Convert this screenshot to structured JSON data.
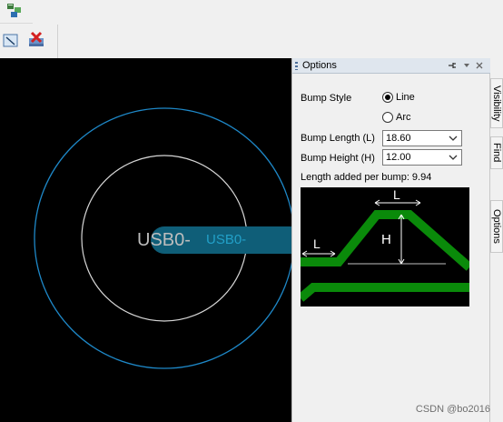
{
  "toolbar": {
    "top_icon": "component-stack-icon",
    "second_icons": [
      "select-rect-icon",
      "delete-red-icon"
    ]
  },
  "canvas": {
    "pad_label": "USB0-",
    "trace_label": "USB0-",
    "colors": {
      "background": "#000000",
      "outer_ring": "#1e88c8",
      "inner_ring": "#d6d6d6",
      "trace": "#0f5e78",
      "pad_text": "#bdbdbd",
      "trace_text": "#22a0c8"
    }
  },
  "options_panel": {
    "title": "Options",
    "bump_style": {
      "label": "Bump Style",
      "options": [
        "Line",
        "Arc"
      ],
      "selected": "Line"
    },
    "bump_length": {
      "label": "Bump Length (L)",
      "value": "18.60"
    },
    "bump_height": {
      "label": "Bump Height (H)",
      "value": "12.00"
    },
    "length_added": "Length added per bump: 9.94",
    "preview": {
      "l_marker": "L",
      "h_marker": "H",
      "colors": {
        "trace": "#0a8a0a",
        "dimension": "#ffffff"
      }
    }
  },
  "side_tabs": [
    "Visibility",
    "Find",
    "Options"
  ],
  "watermark": "CSDN @bo2016"
}
